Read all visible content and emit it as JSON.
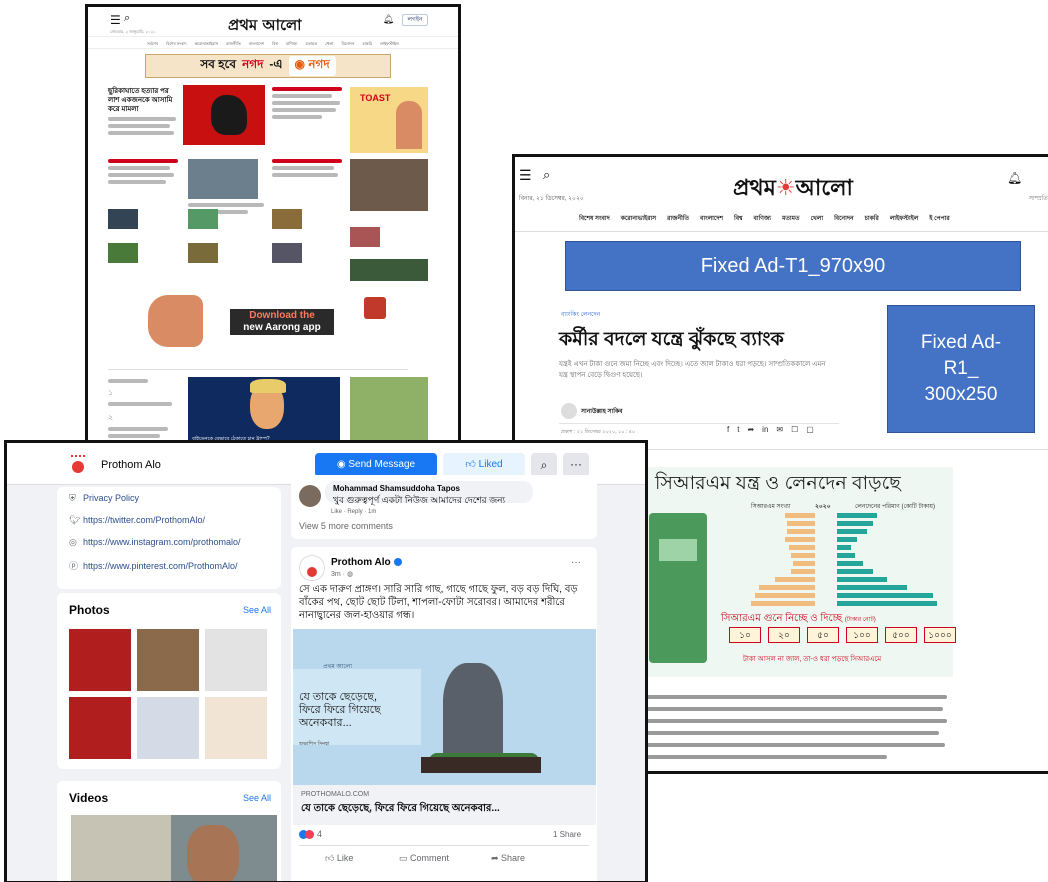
{
  "frame1": {
    "logo": "প্রথম আলো",
    "login_label": "লগইন",
    "date": "সোমবার, ২ জানুয়ারি, ২০২১",
    "nav": [
      "সর্বশেষ",
      "বিশেষ সংবাদ",
      "করোনাভাইরাস",
      "রাজনীতি",
      "বাংলাদেশ",
      "বিশ্ব",
      "বাণিজ্য",
      "মতামত",
      "খেলা",
      "বিনোদন",
      "চাকরি",
      "লাইফস্টাইল"
    ],
    "ad_banner": {
      "text": "সব হবে",
      "brand": "নগদ",
      "suffix": "-এ"
    },
    "hero_headline": "ছুরিকাঘাতে হত্যার পর লাশ একজনকে আসামি করে মামলা",
    "ad_toast_label": "TOAST",
    "aarong_ad": {
      "line1": "Download the",
      "line2": "new Aarong app"
    },
    "trump_caption": "বাইডেনকে যেভাবে ঠেকাতে চান ট্রাম্প?"
  },
  "frame2": {
    "logo_prefix": "প্রথম",
    "logo_suffix": "আলো",
    "date": "বিনার, ২১ ডিসেম্বর, ২০২০",
    "date_right": "সাম্প্রতিক",
    "nav": [
      "বিশেষ সংবাদ",
      "করোনাভাইরাস",
      "রাজনীতি",
      "বাংলাদেশ",
      "বিশ্ব",
      "বাণিজ্য",
      "মতামত",
      "খেলা",
      "বিনোদন",
      "চাকরি",
      "লাইফস্টাইল",
      "ই পেপার"
    ],
    "ad_top": "Fixed Ad-T1_970x90",
    "ad_right_lines": [
      "Fixed Ad-",
      "R1_",
      "300x250"
    ],
    "kicker": "ব্যাংকিং লেনদেন",
    "headline": "কর্মীর বদলে যন্ত্রে ঝুঁকছে ব্যাংক",
    "dek": "যন্ত্রই এখন টাকা গুনে জমা নিচ্ছে এবং দিচ্ছে। এতে জাল টাকাও ধরা পড়ছে। সাম্প্রতিককালে এমন যন্ত্র স্থাপন বেড়ে দ্বিগুণ হয়েছে।",
    "author": "সানাউল্লাহ সাকিব",
    "published": "প্রকাশ : ২১ ডিসেম্বর ২০২০, ১০ : ৪০",
    "share_icons": [
      "f",
      "t",
      "➦",
      "in",
      "✉",
      "☐",
      "▢"
    ],
    "infographic": {
      "title": "সিআরএম যন্ত্র ও লেনদেন বাড়ছে",
      "left_head": "সিআরএম সংখ্যা",
      "year": "২০২০",
      "right_head": "লেনদেনের পরিমাণ (কোটি টাকায়)",
      "notes_title": "সিআরএম গুনে নিচ্ছে ও দিচ্ছে",
      "notes_unit": "(টাকার নোট)",
      "notes": [
        "১০",
        "২০",
        "৫০",
        "১০০",
        "৫০০",
        "১০০০"
      ],
      "footer": "টাকা আসল না জাল, তা-ও ধরা পড়ছে সিআরএমে"
    }
  },
  "frame3": {
    "page_name": "Prothom Alo",
    "send_message": "Send Message",
    "liked": "Liked",
    "links": [
      {
        "icon": "shield",
        "text": "Privacy Policy"
      },
      {
        "icon": "twitter",
        "text": "https://twitter.com/ProthomAlo/"
      },
      {
        "icon": "instagram",
        "text": "https://www.instagram.com/prothomalo/"
      },
      {
        "icon": "pinterest",
        "text": "https://www.pinterest.com/ProthomAlo/"
      }
    ],
    "photos_title": "Photos",
    "see_all": "See All",
    "videos_title": "Videos",
    "comment": {
      "name": "Mohammad Shamsuddoha Tapos",
      "text": "খুব গুরুত্বপূর্ণ একটা নিউজ আমাদের দেশের জন্য",
      "meta": "Like · Reply · 1m"
    },
    "view_more": "View 5 more comments",
    "post": {
      "name": "Prothom Alo",
      "time": "3m · ◍",
      "body": "সে এক দারুণ প্রাঙ্গণ। সারি সারি গাছ, গাছে গাছে ফুল, বড় বড় দিঘি, বড় বাঁকের পথ, ছোট ছোট টিলা, শাপলা-ফোটা সরোবর। আমাদের শরীরে নানাছ্বানের জল-হাওয়ার গন্ধ।",
      "image_label": "প্রথম আলো",
      "image_text_lines": [
        "যে তাকে ছেড়েছে,",
        "ফিরে ফিরে গিয়েছে",
        "অনেকবার..."
      ],
      "image_author": "শুভাশিস সিনহা",
      "domain": "PROTHOMALO.COM",
      "link_title": "যে তাকে ছেড়েছে, ফিরে ফিরে গিয়েছে অনেকবার...",
      "reaction_count": "4",
      "share_count": "1 Share",
      "actions": [
        "Like",
        "Comment",
        "Share"
      ]
    }
  },
  "colors": {
    "fb_blue": "#1877f2",
    "ad_blue": "#4472c4",
    "brand_red": "#e53935",
    "infographic_teal": "#25a69a"
  }
}
